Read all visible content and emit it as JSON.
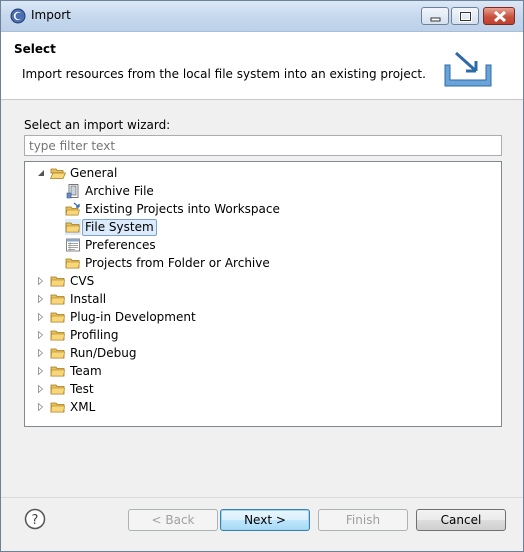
{
  "window": {
    "title": "Import"
  },
  "header": {
    "title": "Select",
    "description": "Import resources from the local file system into an existing project."
  },
  "wizard": {
    "label": "Select an import wizard:",
    "filter_placeholder": "type filter text"
  },
  "tree": [
    {
      "label": "General",
      "expanded": true,
      "level": 0,
      "icon": "folder-open-icon"
    },
    {
      "label": "Archive File",
      "level": 1,
      "icon": "archive-file-icon"
    },
    {
      "label": "Existing Projects into Workspace",
      "level": 1,
      "icon": "existing-projects-icon"
    },
    {
      "label": "File System",
      "level": 1,
      "icon": "folder-icon",
      "selected": true
    },
    {
      "label": "Preferences",
      "level": 1,
      "icon": "preferences-icon"
    },
    {
      "label": "Projects from Folder or Archive",
      "level": 1,
      "icon": "folder-icon"
    },
    {
      "label": "CVS",
      "level": 0,
      "icon": "folder-icon"
    },
    {
      "label": "Install",
      "level": 0,
      "icon": "folder-icon"
    },
    {
      "label": "Plug-in Development",
      "level": 0,
      "icon": "folder-icon"
    },
    {
      "label": "Profiling",
      "level": 0,
      "icon": "folder-icon"
    },
    {
      "label": "Run/Debug",
      "level": 0,
      "icon": "folder-icon"
    },
    {
      "label": "Team",
      "level": 0,
      "icon": "folder-icon"
    },
    {
      "label": "Test",
      "level": 0,
      "icon": "folder-icon"
    },
    {
      "label": "XML",
      "level": 0,
      "icon": "folder-icon"
    }
  ],
  "buttons": {
    "back": "< Back",
    "next": "Next >",
    "finish": "Finish",
    "cancel": "Cancel"
  },
  "colors": {
    "selection": "#dcebfc",
    "folder": "#e8c05a"
  }
}
